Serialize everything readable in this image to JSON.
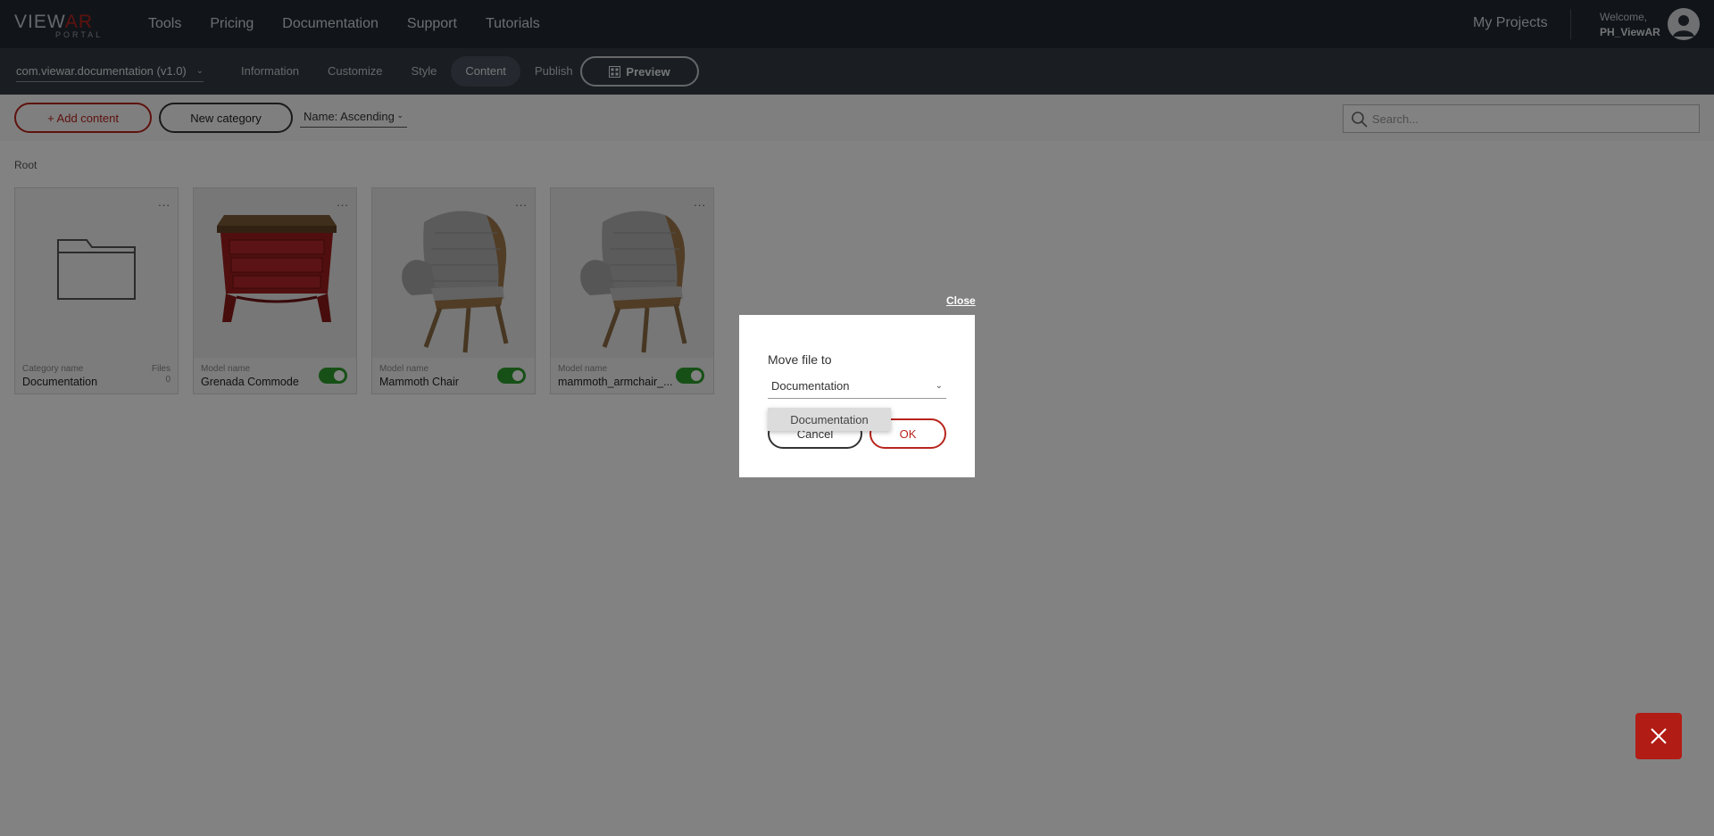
{
  "header": {
    "logo_text_main": "VIEW",
    "logo_text_accent": "AR",
    "logo_sub": "PORTAL",
    "nav": [
      "Tools",
      "Pricing",
      "Documentation",
      "Support",
      "Tutorials"
    ],
    "my_projects": "My Projects",
    "welcome_label": "Welcome,",
    "username": "PH_ViewAR"
  },
  "subbar": {
    "app_selector": "com.viewar.documentation (v1.0)",
    "tabs": [
      "Information",
      "Customize",
      "Style",
      "Content",
      "Publish"
    ],
    "active_tab": "Content",
    "preview_label": "Preview"
  },
  "toolbar": {
    "add_content": "+ Add content",
    "new_category": "New category",
    "sort_value": "Name: Ascending",
    "search_placeholder": "Search..."
  },
  "content": {
    "breadcrumb": "Root",
    "cards": [
      {
        "type": "category",
        "label": "Category name",
        "name": "Documentation",
        "files_label": "Files",
        "files_count": "0"
      },
      {
        "type": "model",
        "label": "Model name",
        "name": "Grenada Commode",
        "enabled": true
      },
      {
        "type": "model",
        "label": "Model name",
        "name": "Mammoth Chair",
        "enabled": true
      },
      {
        "type": "model",
        "label": "Model name",
        "name": "mammoth_armchair_...",
        "enabled": true
      }
    ],
    "card_menu": "..."
  },
  "dialog": {
    "close_label": "Close",
    "title": "Move file to",
    "selected": "Documentation",
    "dropdown_option": "Documentation",
    "cancel_label": "Cancel",
    "ok_label": "OK"
  },
  "colors": {
    "accent": "#b8241c",
    "header_bg": "#232a33",
    "subbar_bg": "#343b44",
    "toggle_on": "#2e9e2c"
  }
}
